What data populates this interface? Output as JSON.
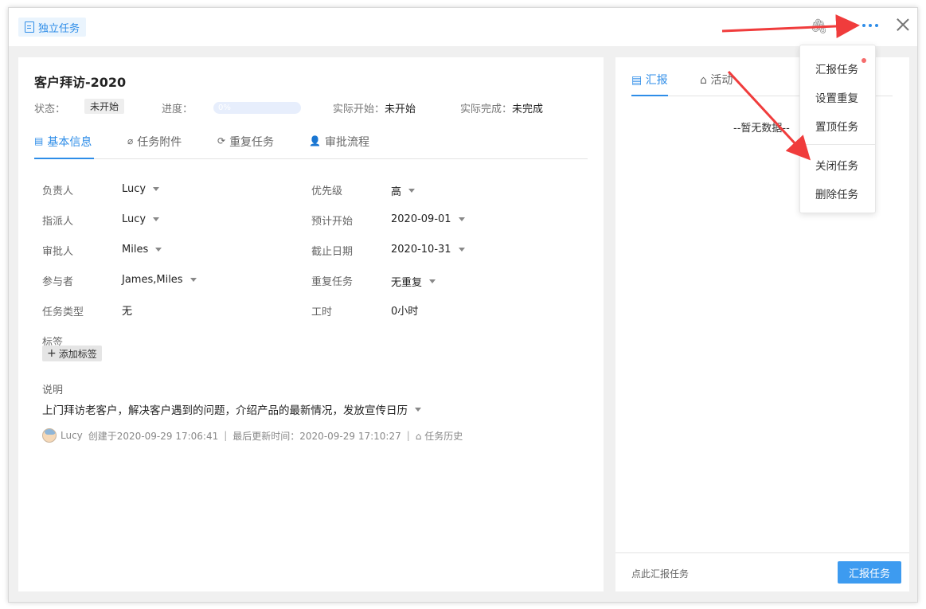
{
  "header": {
    "task_tag": "独立任务"
  },
  "task": {
    "title": "客户拜访-2020",
    "status_label": "状态：",
    "status_value": "未开始",
    "progress_label": "进度：",
    "progress_value": "0%",
    "progress_fraction": 0,
    "actual_start_label": "实际开始：",
    "actual_start_value": "未开始",
    "actual_end_label": "实际完成：",
    "actual_end_value": "未完成"
  },
  "tabs": [
    {
      "label": "基本信息",
      "icon": "document-icon",
      "active": true
    },
    {
      "label": "任务附件",
      "icon": "paperclip-icon",
      "active": false
    },
    {
      "label": "重复任务",
      "icon": "repeat-icon",
      "active": false
    },
    {
      "label": "审批流程",
      "icon": "user-icon",
      "active": false
    }
  ],
  "fields": {
    "owner_label": "负责人",
    "owner_value": "Lucy",
    "assigner_label": "指派人",
    "assigner_value": "Lucy",
    "approver_label": "审批人",
    "approver_value": "Miles",
    "participants_label": "参与者",
    "participants_value": "James,Miles",
    "type_label": "任务类型",
    "type_value": "无",
    "priority_label": "优先级",
    "priority_value": "高",
    "planned_start_label": "预计开始",
    "planned_start_value": "2020-09-01",
    "deadline_label": "截止日期",
    "deadline_value": "2020-10-31",
    "repeat_label": "重复任务",
    "repeat_value": "无重复",
    "hours_label": "工时",
    "hours_value": "0小时",
    "tags_label": "标签",
    "add_tag_label": "添加标签",
    "desc_label": "说明",
    "desc_value": "上门拜访老客户，解决客户遇到的问题，介绍产品的最新情况，发放宣传日历"
  },
  "footer_meta": {
    "user": "Lucy",
    "created": "创建于2020-09-29 17:06:41",
    "updated": "最后更新时间：2020-09-29 17:10:27",
    "history": "任务历史"
  },
  "right_panel": {
    "tab_report": "汇报",
    "tab_activity": "活动",
    "no_data": "--暂无数据--",
    "hint": "点此汇报任务",
    "report_button": "汇报任务"
  },
  "menu": {
    "items": [
      "汇报任务",
      "设置重复",
      "置顶任务",
      "关闭任务",
      "删除任务"
    ]
  },
  "colors": {
    "accent": "#2e8de8",
    "button": "#3d9bf0",
    "arrow": "#f03c3c"
  }
}
